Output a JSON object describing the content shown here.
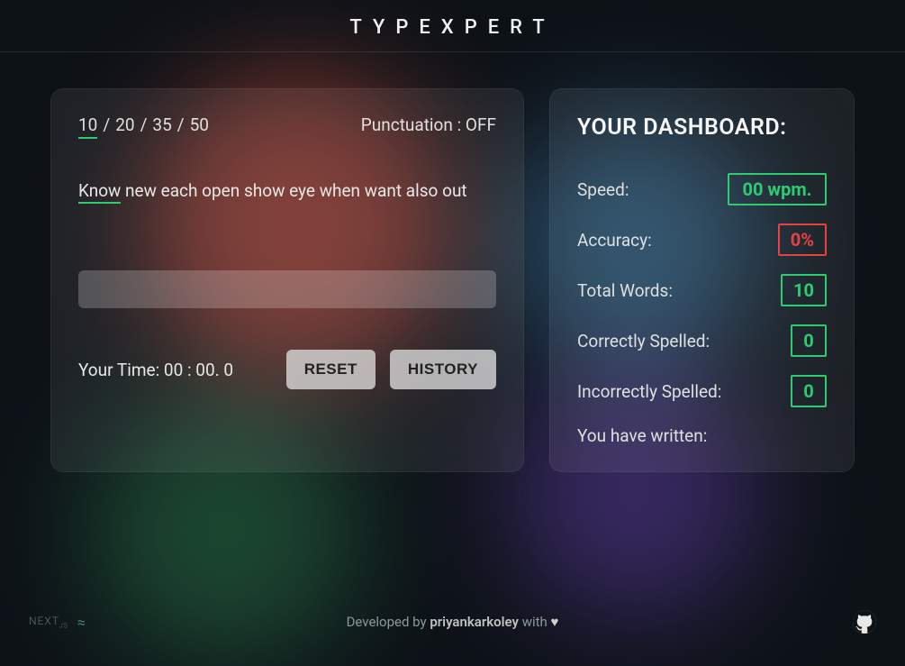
{
  "header": {
    "title": "TYPEXPERT"
  },
  "wordCounts": {
    "options": [
      "10",
      "20",
      "35",
      "50"
    ],
    "activeIndex": 0,
    "separator": "/"
  },
  "punctuation": {
    "label": "Punctuation :",
    "value": "OFF"
  },
  "prompt": {
    "words": [
      "Know",
      "new",
      "each",
      "open",
      "show",
      "eye",
      "when",
      "want",
      "also",
      "out"
    ]
  },
  "input": {
    "value": ""
  },
  "timer": {
    "prefix": "Your Time:",
    "value": "00 : 00. 0"
  },
  "buttons": {
    "reset": "RESET",
    "history": "HISTORY"
  },
  "dashboard": {
    "title": "YOUR DASHBOARD:",
    "rows": {
      "speed": {
        "label": "Speed:",
        "value": "00 wpm.",
        "style": "green-wide"
      },
      "accuracy": {
        "label": "Accuracy:",
        "value": "0%",
        "style": "red"
      },
      "total": {
        "label": "Total Words:",
        "value": "10",
        "style": "green"
      },
      "correct": {
        "label": "Correctly Spelled:",
        "value": "0",
        "style": "green"
      },
      "incorrect": {
        "label": "Incorrectly Spelled:",
        "value": "0",
        "style": "green"
      }
    },
    "written": "You have written:"
  },
  "footer": {
    "developed_prefix": "Developed by",
    "author": "priyankarkoley",
    "with": "with",
    "next": "NEXT",
    "next_suffix": "JS"
  }
}
